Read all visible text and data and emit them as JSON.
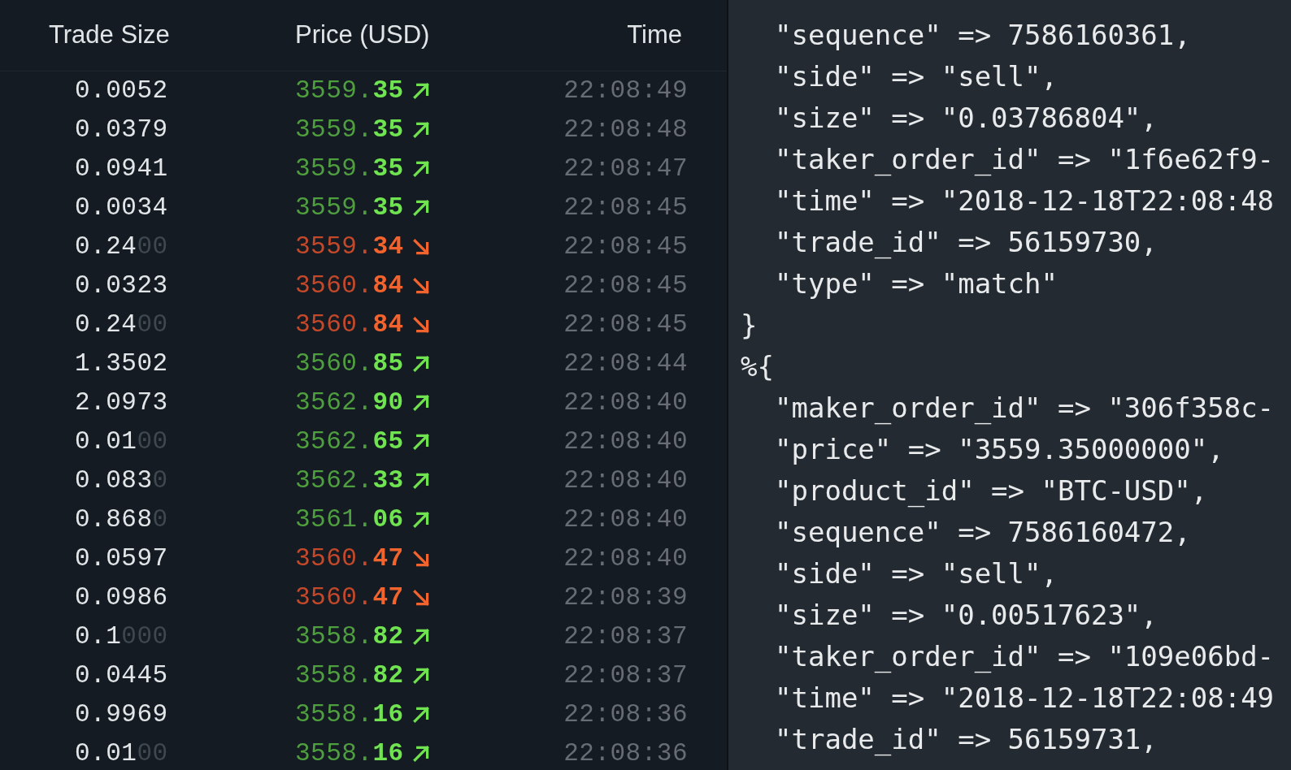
{
  "trades": {
    "columns": [
      "Trade Size",
      "Price (USD)",
      "Time"
    ],
    "rows": [
      {
        "size": "0.0052",
        "size_pad": "",
        "price_base": "3559.",
        "price_tail": "35",
        "rising": true,
        "time": "22:08:49"
      },
      {
        "size": "0.0379",
        "size_pad": "",
        "price_base": "3559.",
        "price_tail": "35",
        "rising": true,
        "time": "22:08:48"
      },
      {
        "size": "0.0941",
        "size_pad": "",
        "price_base": "3559.",
        "price_tail": "35",
        "rising": true,
        "time": "22:08:47"
      },
      {
        "size": "0.0034",
        "size_pad": "",
        "price_base": "3559.",
        "price_tail": "35",
        "rising": true,
        "time": "22:08:45"
      },
      {
        "size": "0.24",
        "size_pad": "00",
        "price_base": "3559.",
        "price_tail": "34",
        "rising": false,
        "time": "22:08:45"
      },
      {
        "size": "0.0323",
        "size_pad": "",
        "price_base": "3560.",
        "price_tail": "84",
        "rising": false,
        "time": "22:08:45"
      },
      {
        "size": "0.24",
        "size_pad": "00",
        "price_base": "3560.",
        "price_tail": "84",
        "rising": false,
        "time": "22:08:45"
      },
      {
        "size": "1.3502",
        "size_pad": "",
        "price_base": "3560.",
        "price_tail": "85",
        "rising": true,
        "time": "22:08:44"
      },
      {
        "size": "2.0973",
        "size_pad": "",
        "price_base": "3562.",
        "price_tail": "90",
        "rising": true,
        "time": "22:08:40"
      },
      {
        "size": "0.01",
        "size_pad": "00",
        "price_base": "3562.",
        "price_tail": "65",
        "rising": true,
        "time": "22:08:40"
      },
      {
        "size": "0.083",
        "size_pad": "0",
        "price_base": "3562.",
        "price_tail": "33",
        "rising": true,
        "time": "22:08:40"
      },
      {
        "size": "0.868",
        "size_pad": "0",
        "price_base": "3561.",
        "price_tail": "06",
        "rising": true,
        "time": "22:08:40"
      },
      {
        "size": "0.0597",
        "size_pad": "",
        "price_base": "3560.",
        "price_tail": "47",
        "rising": false,
        "time": "22:08:40"
      },
      {
        "size": "0.0986",
        "size_pad": "",
        "price_base": "3560.",
        "price_tail": "47",
        "rising": false,
        "time": "22:08:39"
      },
      {
        "size": "0.1",
        "size_pad": "000",
        "price_base": "3558.",
        "price_tail": "82",
        "rising": true,
        "time": "22:08:37"
      },
      {
        "size": "0.0445",
        "size_pad": "",
        "price_base": "3558.",
        "price_tail": "82",
        "rising": true,
        "time": "22:08:37"
      },
      {
        "size": "0.9969",
        "size_pad": "",
        "price_base": "3558.",
        "price_tail": "16",
        "rising": true,
        "time": "22:08:36"
      },
      {
        "size": "0.01",
        "size_pad": "00",
        "price_base": "3558.",
        "price_tail": "16",
        "rising": true,
        "time": "22:08:36"
      }
    ]
  },
  "console": {
    "lines": [
      {
        "kind": "field",
        "text": "\"sequence\" => 7586160361,"
      },
      {
        "kind": "field",
        "text": "\"side\" => \"sell\","
      },
      {
        "kind": "field",
        "text": "\"size\" => \"0.03786804\","
      },
      {
        "kind": "field",
        "text": "\"taker_order_id\" => \"1f6e62f9-"
      },
      {
        "kind": "field",
        "text": "\"time\" => \"2018-12-18T22:08:48"
      },
      {
        "kind": "field",
        "text": "\"trade_id\" => 56159730,"
      },
      {
        "kind": "field",
        "text": "\"type\" => \"match\""
      },
      {
        "kind": "brace",
        "text": "}"
      },
      {
        "kind": "brace",
        "text": "%{"
      },
      {
        "kind": "field",
        "text": "\"maker_order_id\" => \"306f358c-"
      },
      {
        "kind": "field",
        "text": "\"price\" => \"3559.35000000\","
      },
      {
        "kind": "field",
        "text": "\"product_id\" => \"BTC-USD\","
      },
      {
        "kind": "field",
        "text": "\"sequence\" => 7586160472,"
      },
      {
        "kind": "field",
        "text": "\"side\" => \"sell\","
      },
      {
        "kind": "field",
        "text": "\"size\" => \"0.00517623\","
      },
      {
        "kind": "field",
        "text": "\"taker_order_id\" => \"109e06bd-"
      },
      {
        "kind": "field",
        "text": "\"time\" => \"2018-12-18T22:08:49"
      },
      {
        "kind": "field",
        "text": "\"trade_id\" => 56159731,"
      }
    ]
  }
}
